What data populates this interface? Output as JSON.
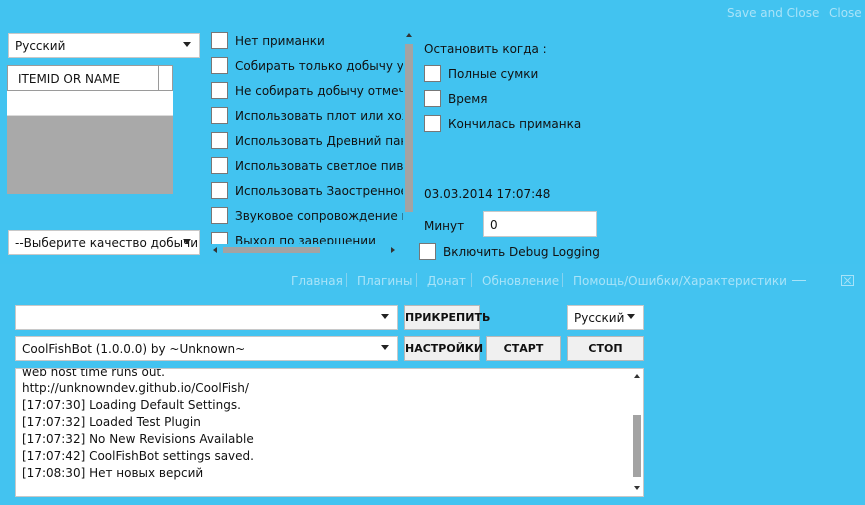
{
  "top_actions": {
    "save_close": "Save and Close",
    "close": "Close"
  },
  "settings": {
    "language": "Русский",
    "item_grid": {
      "column_header": "ITEMID OR NAME"
    },
    "quality_select": "--Выберите качество добычи",
    "options": [
      "Нет приманки",
      "Собирать только добычу указа",
      "Не собирать добычу отмеченн",
      "Использовать плот или хожде",
      "Использовать Древний пандар",
      "Использовать светлое пиво ка",
      "Использовать Заостренное ко",
      "Звуковое сопровождение при",
      "Выход по завершении"
    ],
    "stop_when": {
      "title": "Остановить когда :",
      "items": [
        "Полные сумки",
        "Время",
        "Кончилась приманка"
      ]
    },
    "date_time": "03.03.2014 17:07:48",
    "minutes_label": "Минут",
    "minutes_value": "0",
    "debug_logging": "Включить Debug Logging"
  },
  "main": {
    "nav": [
      "Главная",
      "Плагины",
      "Донат",
      "Обновление",
      "Помощь/Ошибки/Характеристики"
    ],
    "plugin_select": "",
    "bot_select": "CoolFishBot (1.0.0.0) by ~Unknown~",
    "attach_button": "ПРИКРЕПИТЬ",
    "settings_button": "НАСТРОЙКИ",
    "start_button": "СТАРТ",
    "stop_button": "СТОП",
    "language": "Русский",
    "log_lines": [
      "web host time runs out.",
      "http://unknowndev.github.io/CoolFish/",
      "[17:07:30]  Loading Default Settings.",
      "[17:07:32]  Loaded Test Plugin",
      "[17:07:32]  No New Revisions Available",
      "[17:07:42]  CoolFishBot settings saved.",
      "[17:08:30]  Нет новых версий"
    ]
  }
}
